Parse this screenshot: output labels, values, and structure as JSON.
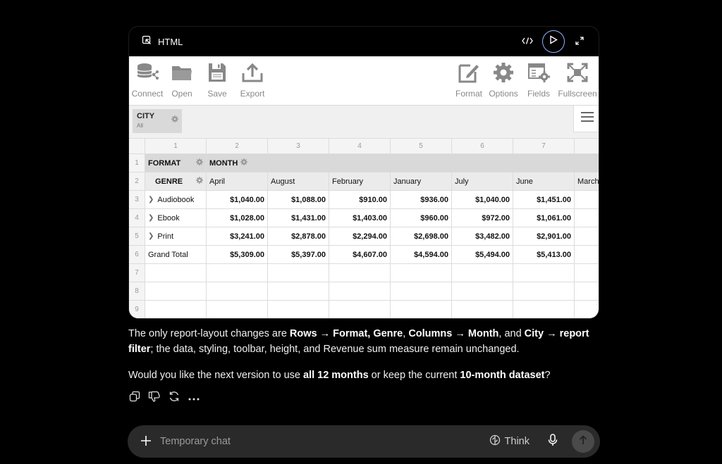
{
  "artifact": {
    "title": "HTML",
    "toolbar_left": [
      {
        "key": "connect",
        "label": "Connect"
      },
      {
        "key": "open",
        "label": "Open"
      },
      {
        "key": "save",
        "label": "Save"
      },
      {
        "key": "export",
        "label": "Export"
      }
    ],
    "toolbar_right": [
      {
        "key": "format",
        "label": "Format"
      },
      {
        "key": "options",
        "label": "Options"
      },
      {
        "key": "fields",
        "label": "Fields"
      },
      {
        "key": "fullscreen",
        "label": "Fullscreen"
      }
    ],
    "report_filter": {
      "label": "CITY",
      "value": "All"
    }
  },
  "pivot": {
    "column_numbers": [
      "1",
      "2",
      "3",
      "4",
      "5",
      "6",
      "7",
      ""
    ],
    "row_numbers": [
      "1",
      "2",
      "3",
      "4",
      "5",
      "6",
      "7",
      "8",
      "9"
    ],
    "row_field": "FORMAT",
    "column_field": "MONTH",
    "subrow_field": "GENRE",
    "months": [
      "April",
      "August",
      "February",
      "January",
      "July",
      "June",
      "March"
    ],
    "rows": [
      {
        "label": "Audiobook",
        "expandable": true,
        "values": [
          "$1,040.00",
          "$1,088.00",
          "$910.00",
          "$936.00",
          "$1,040.00",
          "$1,451.00",
          ""
        ]
      },
      {
        "label": "Ebook",
        "expandable": true,
        "values": [
          "$1,028.00",
          "$1,431.00",
          "$1,403.00",
          "$960.00",
          "$972.00",
          "$1,061.00",
          ""
        ]
      },
      {
        "label": "Print",
        "expandable": true,
        "values": [
          "$3,241.00",
          "$2,878.00",
          "$2,294.00",
          "$2,698.00",
          "$3,482.00",
          "$2,901.00",
          ""
        ]
      },
      {
        "label": "Grand Total",
        "expandable": false,
        "values": [
          "$5,309.00",
          "$5,397.00",
          "$4,607.00",
          "$4,594.00",
          "$5,494.00",
          "$5,413.00",
          ""
        ]
      }
    ]
  },
  "message": {
    "p1": [
      {
        "t": "The only report-layout changes are ",
        "b": false
      },
      {
        "t": "Rows → Format, Genre",
        "b": true
      },
      {
        "t": ", ",
        "b": false
      },
      {
        "t": "Columns → Month",
        "b": true
      },
      {
        "t": ", and ",
        "b": false
      },
      {
        "t": "City → report filter",
        "b": true
      },
      {
        "t": "; the data, styling, toolbar, height, and Revenue sum measure remain unchanged.",
        "b": false
      }
    ],
    "p2": [
      {
        "t": "Would you like the next version to use ",
        "b": false
      },
      {
        "t": "all 12 months",
        "b": true
      },
      {
        "t": " or keep the current ",
        "b": false
      },
      {
        "t": "10-month dataset",
        "b": true
      },
      {
        "t": "?",
        "b": false
      }
    ]
  },
  "composer": {
    "placeholder": "Temporary chat",
    "think_label": "Think"
  }
}
